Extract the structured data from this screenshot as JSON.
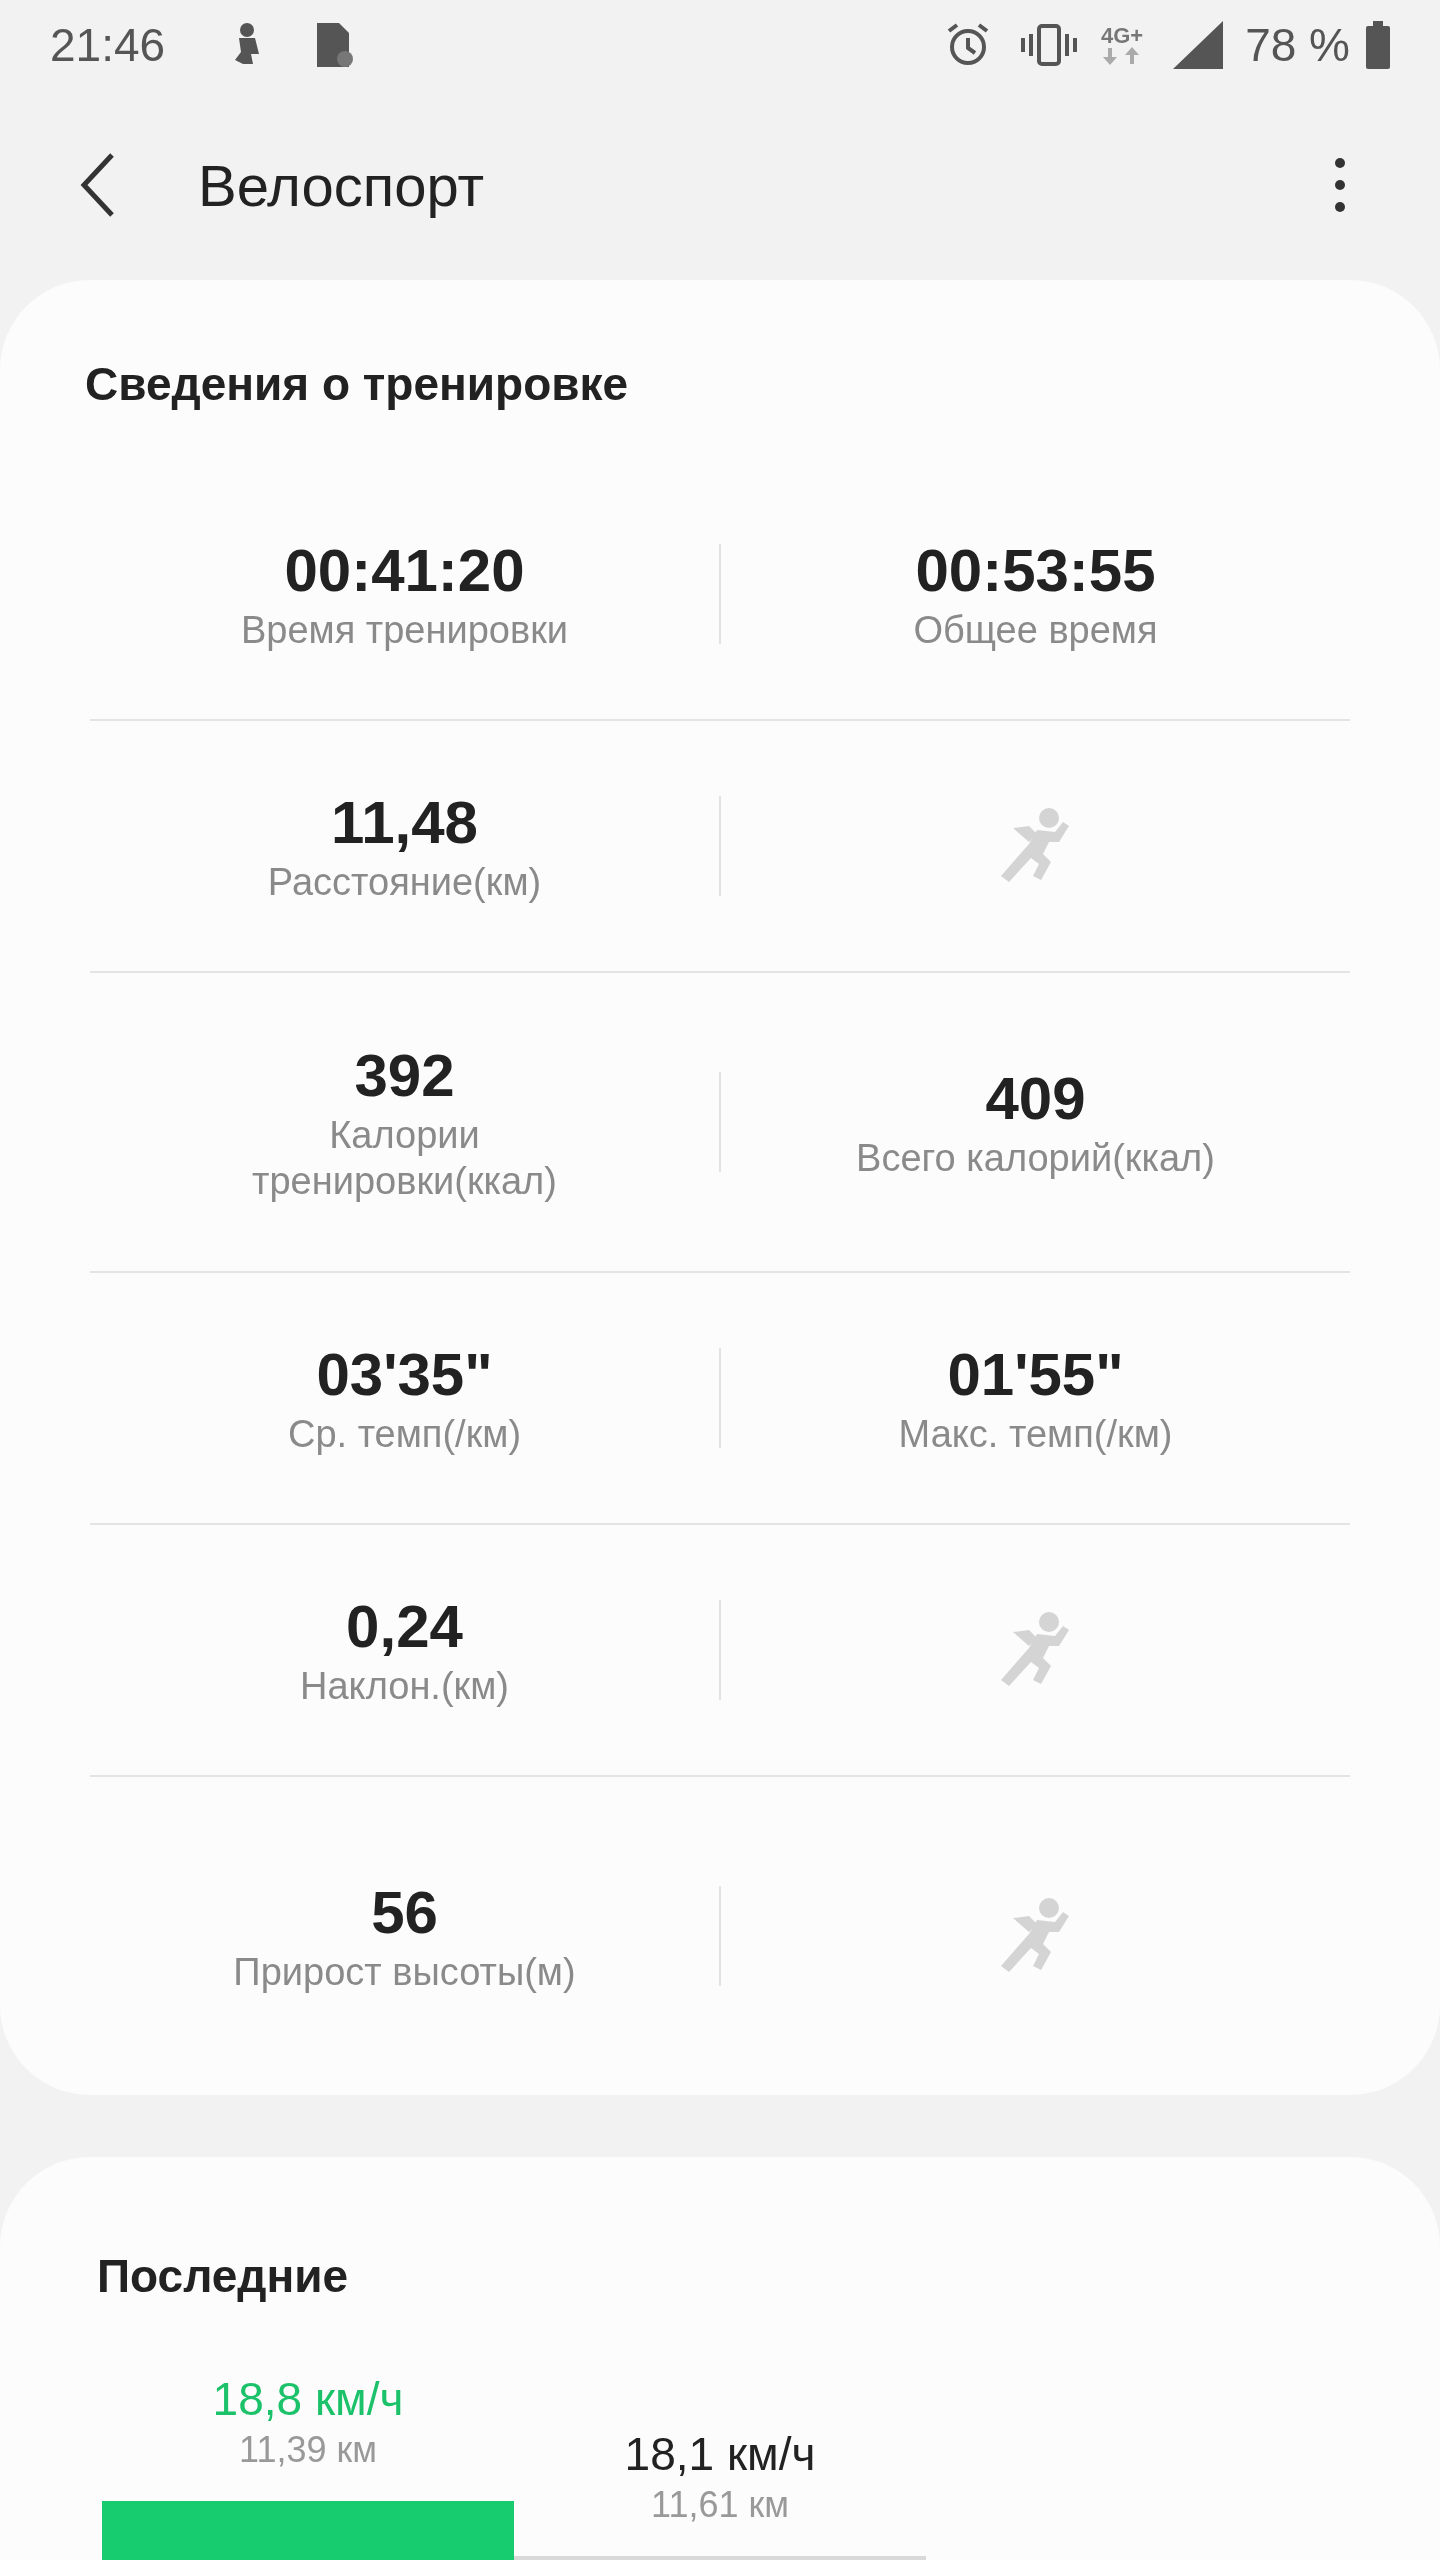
{
  "status_bar": {
    "time": "21:46",
    "battery": "78 %",
    "network": "4G+"
  },
  "app_bar": {
    "title": "Велоспорт"
  },
  "summary": {
    "title": "Сведения о тренировке",
    "rows": [
      {
        "cells": [
          {
            "kind": "value",
            "value": "00:41:20",
            "label": "Время тренировки"
          },
          {
            "kind": "value",
            "value": "00:53:55",
            "label": "Общее время"
          }
        ]
      },
      {
        "cells": [
          {
            "kind": "value",
            "value": "11,48",
            "label": "Расстояние(км)"
          },
          {
            "kind": "empty"
          }
        ]
      },
      {
        "cells": [
          {
            "kind": "value",
            "value": "392",
            "label": "Калории\nтренировки(ккал)"
          },
          {
            "kind": "value",
            "value": "409",
            "label": "Всего калорий(ккал)"
          }
        ]
      },
      {
        "cells": [
          {
            "kind": "value",
            "value": "03'35\"",
            "label": "Ср. темп(/км)"
          },
          {
            "kind": "value",
            "value": "01'55\"",
            "label": "Макс. темп(/км)"
          }
        ]
      },
      {
        "cells": [
          {
            "kind": "value",
            "value": "0,24",
            "label": "Наклон.(км)"
          },
          {
            "kind": "empty"
          }
        ]
      },
      {
        "cells": [
          {
            "kind": "value",
            "value": "56",
            "label": "Прирост высоты(м)"
          },
          {
            "kind": "empty"
          }
        ]
      }
    ]
  },
  "recent": {
    "title": "Последние",
    "items": [
      {
        "speed": "18,8 км/ч",
        "distance": "11,39 км",
        "selected": true
      },
      {
        "speed": "18,1 км/ч",
        "distance": "11,61 км",
        "selected": false
      }
    ]
  }
}
